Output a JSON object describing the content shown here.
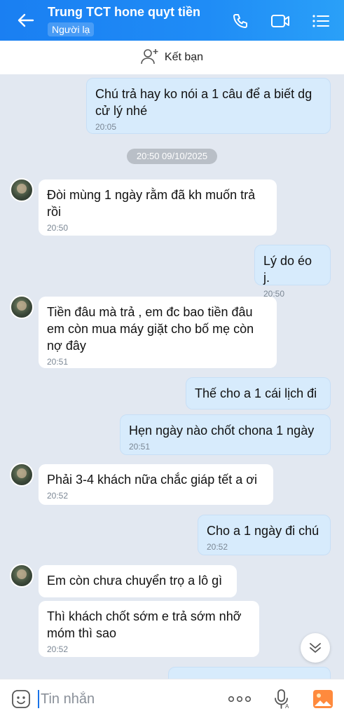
{
  "header": {
    "title": "Trung TCT hone quyt tiền",
    "badge": "Người lạ"
  },
  "add_friend": {
    "label": "Kết bạn"
  },
  "date_separator": "20:50 09/10/2025",
  "messages": [
    {
      "side": "out",
      "text": "Chú trả hay ko nói a 1 câu để a biết dg cử lý nhé",
      "time": "20:05"
    },
    {
      "side": "in",
      "text": "Đòi mùng 1 ngày rằm đã kh muốn trả rồi",
      "time": "20:50"
    },
    {
      "side": "out",
      "text": "Lý do éo j.",
      "time": "20:50"
    },
    {
      "side": "in",
      "text": "Tiền đâu mà trả , em đc bao tiền đâu em còn mua máy giặt cho bố mẹ còn nợ đây",
      "time": "20:51"
    },
    {
      "side": "out",
      "text": "Thế cho a 1 cái lịch đi",
      "time": ""
    },
    {
      "side": "out",
      "text": "Hẹn ngày nào chốt chona 1 ngày",
      "time": "20:51"
    },
    {
      "side": "in",
      "text": "Phải 3-4 khách nữa chắc giáp tết a ơi",
      "time": "20:52"
    },
    {
      "side": "out",
      "text": "Cho a 1 ngày đi chú",
      "time": "20:52"
    },
    {
      "side": "in",
      "text": "Em còn chưa chuyển trọ a lô gì",
      "time": ""
    },
    {
      "side": "in",
      "text": "Thì khách chốt sớm e trả sớm nhỡ móm thì sao",
      "time": "20:52"
    }
  ],
  "composer": {
    "placeholder": "Tin nhắn"
  },
  "colors": {
    "header": "#1f8cf6",
    "outgoing_bubble": "#d7ebfc",
    "incoming_bubble": "#ffffff",
    "background": "#e2e8f1"
  },
  "icons": [
    "back-arrow-icon",
    "phone-icon",
    "video-call-icon",
    "menu-list-icon",
    "add-friend-icon",
    "scroll-down-chevron-icon",
    "sticker-icon",
    "more-icon",
    "mic-icon",
    "image-icon"
  ]
}
